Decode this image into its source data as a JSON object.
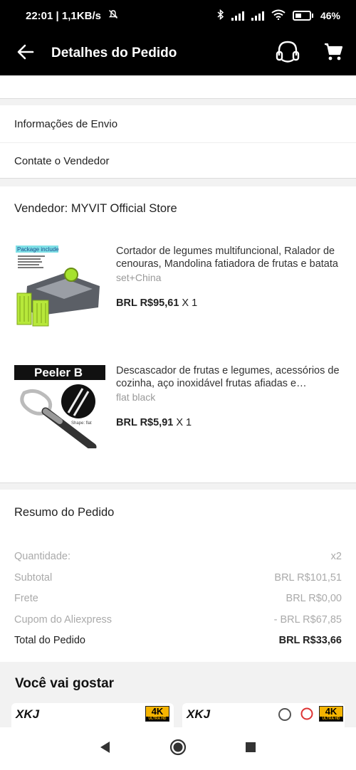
{
  "status": {
    "time": "22:01",
    "speed": "1,1KB/s",
    "battery": "46%"
  },
  "appbar": {
    "title": "Detalhes do Pedido"
  },
  "links": [
    "Informações de Envio",
    "Contate o Vendedor"
  ],
  "seller": "Vendedor: MYVIT Official Store",
  "products": [
    {
      "name": "Cortador de legumes multifuncional, Ralador de cenouras, Mandolina fatiadora de frutas e batata",
      "variant": "set+China",
      "price": "BRL R$95,61",
      "qty": "X 1",
      "thumb_label": "Package include"
    },
    {
      "name": "Descascador de frutas e legumes, acessórios de cozinha, aço inoxidável frutas afiadas e descascador",
      "variant": "flat black",
      "price": "BRL R$5,91",
      "qty": "X 1",
      "thumb_label": "Peeler B",
      "thumb_caption": "Shape: flat"
    }
  ],
  "summary": {
    "title": "Resumo do Pedido",
    "rows": [
      {
        "label": "Quantidade:",
        "value": "x2"
      },
      {
        "label": "Subtotal",
        "value": "BRL R$101,51"
      },
      {
        "label": "Frete",
        "value": "BRL R$0,00"
      },
      {
        "label": "Cupom do Aliexpress",
        "value": "- BRL R$67,85"
      }
    ],
    "total": {
      "label": "Total do Pedido",
      "value": "BRL R$33,66"
    }
  },
  "recommend": {
    "title": "Você vai gostar",
    "badge": "4K",
    "badge_sub": "ULTRA HD",
    "brand": "XKJ"
  },
  "icons": {
    "back": "arrow-left-icon",
    "support": "headset-icon",
    "cart": "cart-icon"
  },
  "colors": {
    "header_bg": "#000000",
    "badge_yellow": "#f5b400",
    "muted_text": "#aaaaaa"
  }
}
